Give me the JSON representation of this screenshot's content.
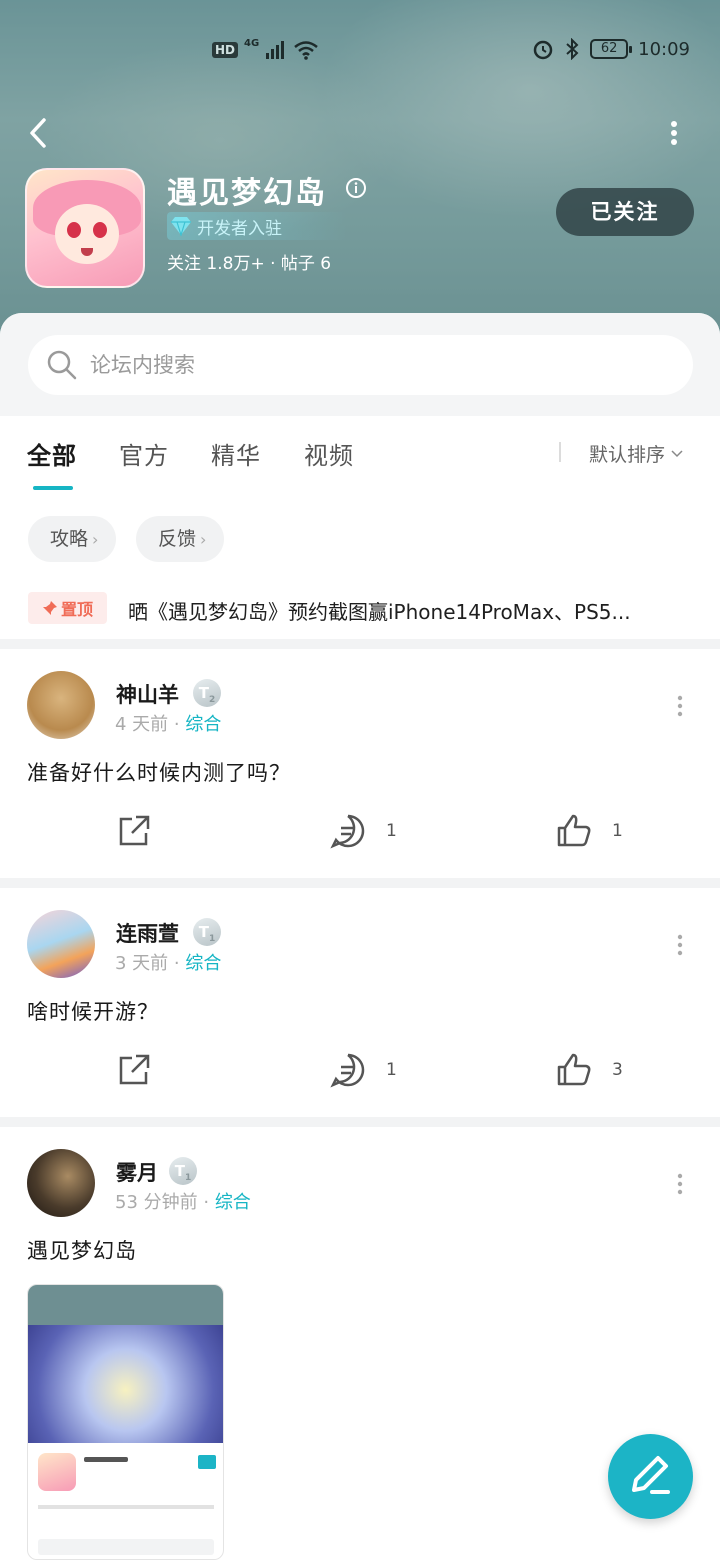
{
  "status_bar": {
    "hd": "HD",
    "network": "4G",
    "battery": "62",
    "time": "10:09"
  },
  "header": {
    "title": "遇见梦幻岛",
    "developer_badge": "开发者入驻",
    "stats": "关注 1.8万+ · 帖子 6",
    "follow_label": "已关注"
  },
  "search": {
    "placeholder": "论坛内搜索"
  },
  "tabs": [
    {
      "label": "全部",
      "active": true
    },
    {
      "label": "官方",
      "active": false
    },
    {
      "label": "精华",
      "active": false
    },
    {
      "label": "视频",
      "active": false
    }
  ],
  "sort_label": "默认排序",
  "chips": [
    {
      "label": "攻略"
    },
    {
      "label": "反馈"
    }
  ],
  "pinned": {
    "badge": "置顶",
    "text": "晒《遇见梦幻岛》预约截图赢iPhone14ProMax、PS5..."
  },
  "posts": [
    {
      "author": "神山羊",
      "level": "T",
      "level_num": "2",
      "time": "4 天前",
      "category": "综合",
      "content": "准备好什么时候内测了吗？",
      "comments": "1",
      "likes": "1"
    },
    {
      "author": "连雨萱",
      "level": "T",
      "level_num": "1",
      "time": "3 天前",
      "category": "综合",
      "content": "啥时候开游？",
      "comments": "1",
      "likes": "3"
    },
    {
      "author": "雾月",
      "level": "T",
      "level_num": "1",
      "time": "53 分钟前",
      "category": "综合",
      "content": "遇见梦幻岛"
    }
  ],
  "colors": {
    "accent": "#16b5c4",
    "pin": "#f06c57",
    "banner": "#8fb3b2"
  },
  "icons": [
    "back-icon",
    "more-vertical-icon",
    "info-icon",
    "diamond-icon",
    "search-icon",
    "pin-icon",
    "share-icon",
    "comment-icon",
    "like-icon",
    "edit-icon"
  ]
}
